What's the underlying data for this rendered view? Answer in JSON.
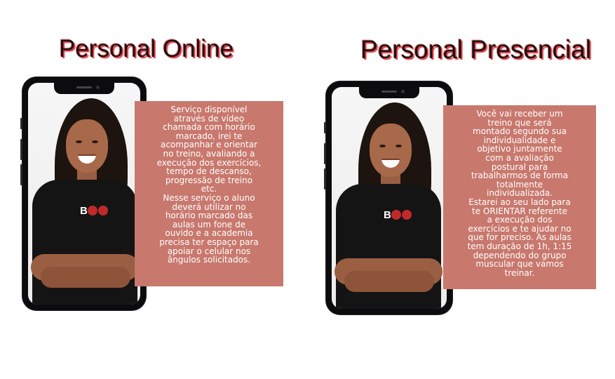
{
  "online": {
    "title": "Personal Online",
    "description": "Serviço disponível\natravés de vídeo\nchamada com horário\nmarcado, irei te\nacompanhar e orientar\nno treino, avaliando a\nexecução dos exercícios,\ntempo de descanso,\nprogressão de treino\netc.\nNesse serviço o aluno\ndeverá utilizar no\nhorário marcado das\naulas um fone de\nouvido e a academia\nprecisa ter espaço para\napoiar o celular nos\nângulos solicitados.",
    "logo_text": "B"
  },
  "presencial": {
    "title": "Personal Presencial",
    "description": "Você vai receber um\ntreino que será\nmontado segundo sua\nindividualidade e\nobjetivo juntamente\ncom a avaliação\npostural para\ntrabalharmos de forma\ntotalmente\nindividualizada.\nEstarei ao seu lado para\nte ORIENTAR referente\na execução dos\nexercícios e te ajudar no\nque for preciso. As aulas\ntem duração de 1h, 1:15\ndependendo do grupo\nmuscular que vamos\ntreinar.",
    "logo_text": "B"
  },
  "colors": {
    "text_box": "#c8786d",
    "title_glow": "#e8373f",
    "phone_frame": "#0c0c0e"
  }
}
